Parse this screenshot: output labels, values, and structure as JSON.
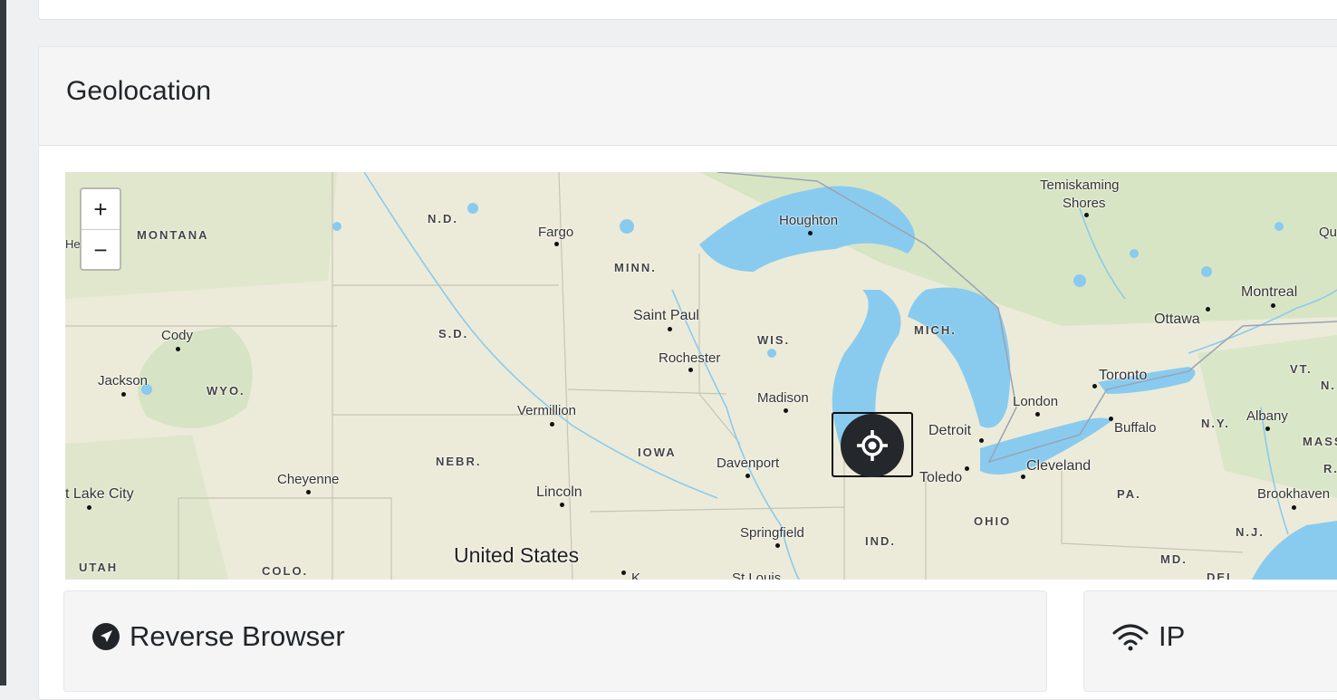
{
  "panel": {
    "title": "Geolocation"
  },
  "map": {
    "zoom_in": "+",
    "zoom_out": "−",
    "labels": {
      "montana": "MONTANA",
      "he": "He",
      "nd": "N.D.",
      "fargo": "Fargo",
      "minn": "MINN.",
      "houghton": "Houghton",
      "temiskaming": "Temiskaming",
      "shores": "Shores",
      "qu": "Qu",
      "montreal": "Montreal",
      "ottawa": "Ottawa",
      "cody": "Cody",
      "sd": "S.D.",
      "saint_paul": "Saint Paul",
      "wis": "WIS.",
      "mich": "MICH.",
      "jackson": "Jackson",
      "wyo": "WYO.",
      "rochester": "Rochester",
      "toronto": "Toronto",
      "vt": "VT.",
      "n": "N.",
      "madison": "Madison",
      "london": "London",
      "vermillion": "Vermillion",
      "detroit": "Detroit",
      "buffalo": "Buffalo",
      "ny": "N.Y.",
      "albany": "Albany",
      "mass": "MASS",
      "iowa": "IOWA",
      "nebr": "NEBR.",
      "davenport": "Davenport",
      "toledo": "Toledo",
      "cleveland": "Cleveland",
      "r": "R.",
      "cheyenne": "Cheyenne",
      "lake_city": "t Lake City",
      "lincoln": "Lincoln",
      "pa": "PA.",
      "brookhaven": "Brookhaven",
      "ohio": "OHIO",
      "springfield": "Springfield",
      "nj": "N.J.",
      "united_states": "United States",
      "ind": "IND.",
      "utah": "UTAH",
      "colo": "COLO.",
      "md": "MD.",
      "del": "DEL",
      "st_louis": "St Louis",
      "k": "K"
    }
  },
  "cards": {
    "reverse": {
      "title": "Reverse Browser",
      "icon": "location-arrow-icon"
    },
    "ip": {
      "title": "IP",
      "icon": "wifi-icon"
    }
  },
  "colors": {
    "water": "#89cbee",
    "land": "#ecebd9",
    "forest": "#d6e3c4",
    "dark": "#24272b"
  }
}
